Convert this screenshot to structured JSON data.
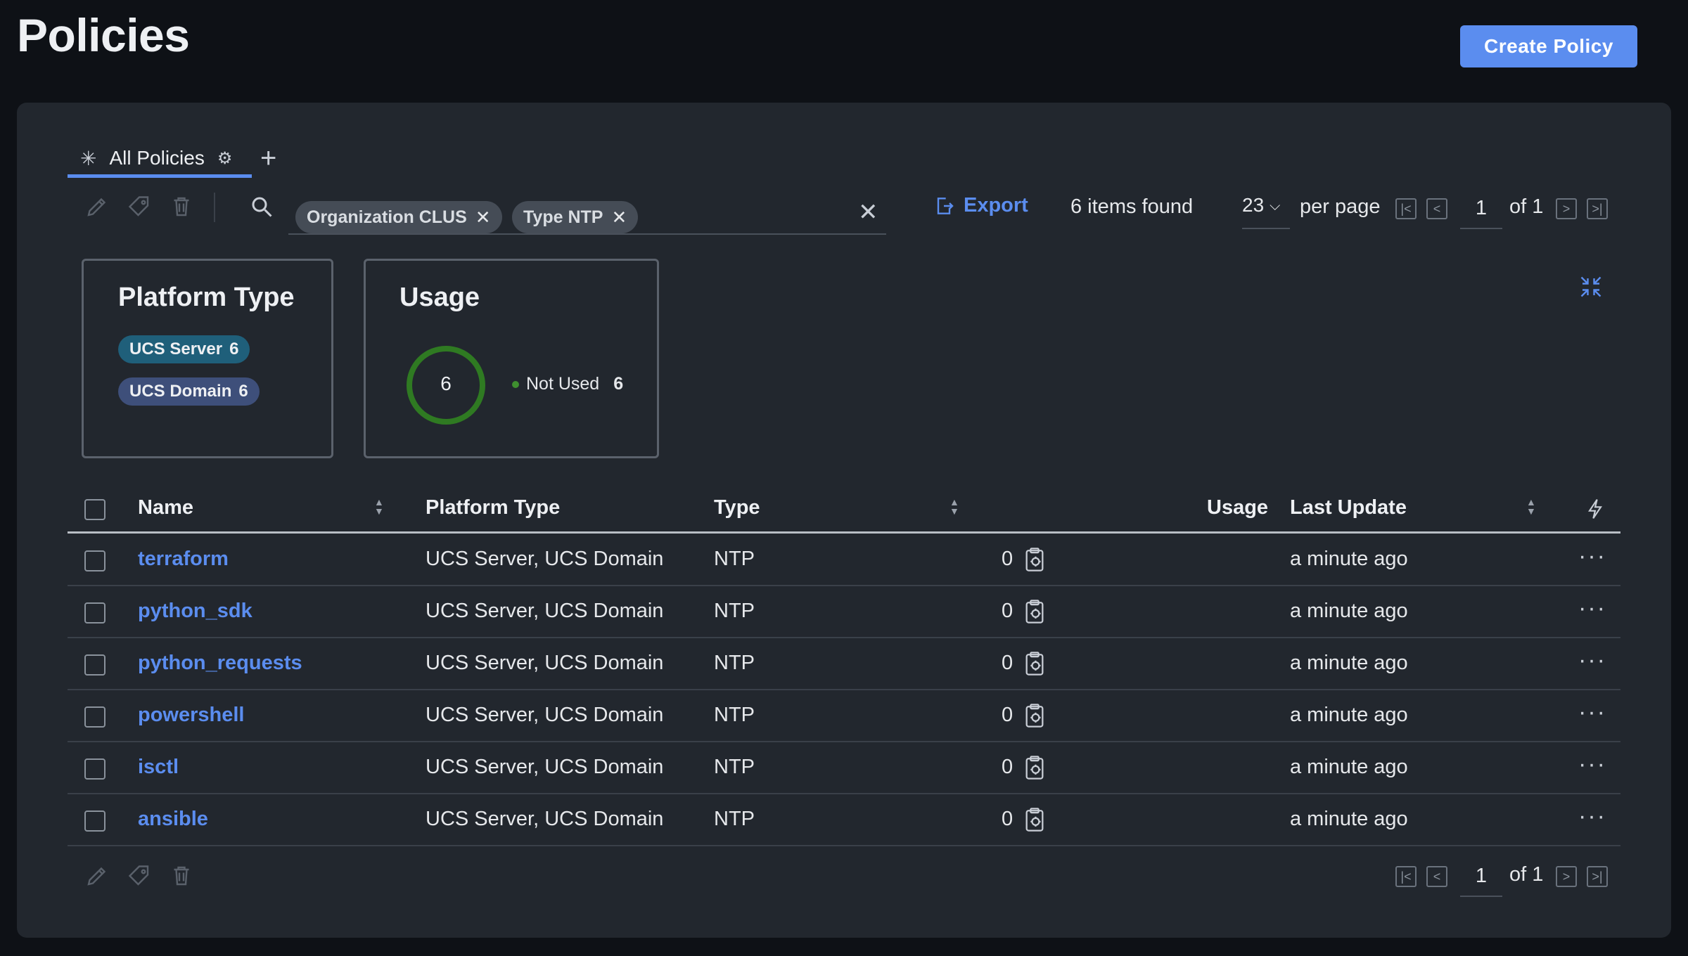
{
  "header": {
    "title": "Policies",
    "create_label": "Create Policy"
  },
  "tabs": [
    {
      "label": "All Policies"
    }
  ],
  "filters": {
    "chips": [
      {
        "label": "Organization CLUS"
      },
      {
        "label": "Type NTP"
      }
    ],
    "export_label": "Export",
    "items_found": "6 items found",
    "per_page_value": "23",
    "per_page_label": "per page",
    "page": "1",
    "of_label": "of 1"
  },
  "summary": {
    "platform": {
      "title": "Platform Type",
      "badges": [
        {
          "label": "UCS Server",
          "count": "6",
          "color": "#1f5f7a"
        },
        {
          "label": "UCS Domain",
          "count": "6",
          "color": "#3e4f7a"
        }
      ]
    },
    "usage": {
      "title": "Usage",
      "total": "6",
      "legend": [
        {
          "label": "Not Used",
          "count": "6",
          "color": "#3f8f2f"
        }
      ]
    }
  },
  "table": {
    "columns": {
      "name": "Name",
      "platform": "Platform Type",
      "type": "Type",
      "usage": "Usage",
      "last_update": "Last Update"
    },
    "rows": [
      {
        "name": "terraform",
        "platform": "UCS Server, UCS Domain",
        "type": "NTP",
        "usage": "0",
        "last_update": "a minute ago"
      },
      {
        "name": "python_sdk",
        "platform": "UCS Server, UCS Domain",
        "type": "NTP",
        "usage": "0",
        "last_update": "a minute ago"
      },
      {
        "name": "python_requests",
        "platform": "UCS Server, UCS Domain",
        "type": "NTP",
        "usage": "0",
        "last_update": "a minute ago"
      },
      {
        "name": "powershell",
        "platform": "UCS Server, UCS Domain",
        "type": "NTP",
        "usage": "0",
        "last_update": "a minute ago"
      },
      {
        "name": "isctl",
        "platform": "UCS Server, UCS Domain",
        "type": "NTP",
        "usage": "0",
        "last_update": "a minute ago"
      },
      {
        "name": "ansible",
        "platform": "UCS Server, UCS Domain",
        "type": "NTP",
        "usage": "0",
        "last_update": "a minute ago"
      }
    ]
  },
  "footer": {
    "page": "1",
    "of_label": "of 1"
  },
  "colors": {
    "accent": "#5b8def",
    "panel": "#22272e",
    "background": "#0e1116",
    "usage_ring": "#2f7a22"
  },
  "icons": [
    "edit-icon",
    "tag-icon",
    "trash-icon",
    "search-icon",
    "close-icon",
    "export-icon",
    "chevron-down-icon",
    "first-page-icon",
    "prev-page-icon",
    "next-page-icon",
    "last-page-icon",
    "collapse-icon",
    "sort-icon",
    "bolt-icon",
    "usage-report-icon",
    "more-icon",
    "gear-icon",
    "add-icon",
    "asterisk-icon"
  ]
}
